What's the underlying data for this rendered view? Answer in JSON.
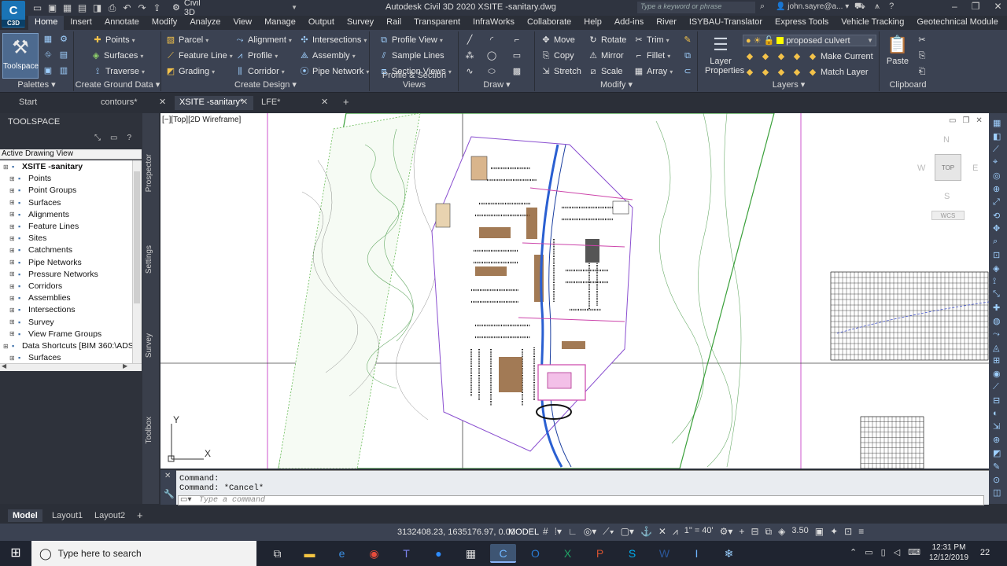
{
  "title_bar": {
    "app_logo": "C",
    "app_logo_sub": "C3D",
    "workspace": "Civil 3D",
    "window_title": "Autodesk Civil 3D 2020    XSITE -sanitary.dwg",
    "search_placeholder": "Type a keyword or phrase",
    "user": "john.sayre@a..."
  },
  "ribbon_tabs": [
    "Home",
    "Insert",
    "Annotate",
    "Modify",
    "Analyze",
    "View",
    "Manage",
    "Output",
    "Survey",
    "Rail",
    "Transparent",
    "InfraWorks",
    "Collaborate",
    "Help",
    "Add-ins",
    "River",
    "ISYBAU-Translator",
    "Express Tools",
    "Vehicle Tracking",
    "Geotechnical Module",
    "Vault"
  ],
  "active_tab": "Home",
  "ribbon": {
    "palettes": {
      "title": "Palettes",
      "toolspace": "Toolspace"
    },
    "ground": {
      "title": "Create Ground Data",
      "points": "Points",
      "surfaces": "Surfaces",
      "traverse": "Traverse"
    },
    "design": {
      "title": "Create Design",
      "parcel": "Parcel",
      "feature_line": "Feature Line",
      "grading": "Grading",
      "alignment": "Alignment",
      "profile": "Profile",
      "corridor": "Corridor",
      "intersections": "Intersections",
      "assembly": "Assembly",
      "pipe_network": "Pipe Network"
    },
    "views": {
      "title": "Profile & Section Views",
      "profile_view": "Profile View",
      "sample_lines": "Sample Lines",
      "section_views": "Section Views"
    },
    "draw": {
      "title": "Draw"
    },
    "modify": {
      "title": "Modify",
      "move": "Move",
      "copy": "Copy",
      "stretch": "Stretch",
      "rotate": "Rotate",
      "mirror": "Mirror",
      "scale": "Scale",
      "trim": "Trim",
      "fillet": "Fillet",
      "array": "Array"
    },
    "layers": {
      "title": "Layers",
      "layer_properties": "Layer Properties",
      "current_layer": "proposed culvert",
      "make_current": "Make Current",
      "match_layer": "Match Layer"
    },
    "clipboard": {
      "title": "Clipboard",
      "paste": "Paste"
    }
  },
  "doc_tabs": [
    {
      "label": "Start"
    },
    {
      "label": "contours*"
    },
    {
      "label": "XSITE -sanitary*"
    },
    {
      "label": "LFE*"
    }
  ],
  "new_tab_symbol": "+",
  "toolspace": {
    "header": "TOOLSPACE",
    "view_selector": "Active Drawing View",
    "tree": [
      {
        "label": "XSITE -sanitary",
        "level": 0,
        "bold": true
      },
      {
        "label": "Points",
        "level": 1
      },
      {
        "label": "Point Groups",
        "level": 1
      },
      {
        "label": "Surfaces",
        "level": 1
      },
      {
        "label": "Alignments",
        "level": 1
      },
      {
        "label": "Feature Lines",
        "level": 1
      },
      {
        "label": "Sites",
        "level": 1
      },
      {
        "label": "Catchments",
        "level": 1
      },
      {
        "label": "Pipe Networks",
        "level": 1
      },
      {
        "label": "Pressure Networks",
        "level": 1
      },
      {
        "label": "Corridors",
        "level": 1
      },
      {
        "label": "Assemblies",
        "level": 1
      },
      {
        "label": "Intersections",
        "level": 1
      },
      {
        "label": "Survey",
        "level": 1
      },
      {
        "label": "View Frame Groups",
        "level": 1
      },
      {
        "label": "Data Shortcuts [BIM 360:\\ADS...",
        "level": 0
      },
      {
        "label": "Surfaces",
        "level": 1
      }
    ],
    "side_tabs": [
      "Prospector",
      "Settings",
      "Survey",
      "Toolbox"
    ]
  },
  "viewport": {
    "label": "[−][Top][2D Wireframe]",
    "viewcube": {
      "n": "N",
      "s": "S",
      "e": "E",
      "w": "W",
      "top": "TOP",
      "wcs": "WCS"
    },
    "ucs_x": "X",
    "ucs_y": "Y"
  },
  "command": {
    "history": [
      "Command:",
      "Command: *Cancel*"
    ],
    "placeholder": "Type a command"
  },
  "layout_tabs": [
    "Model",
    "Layout1",
    "Layout2"
  ],
  "layout_add": "+",
  "status": {
    "coords": "3132408.23, 1635176.97, 0.00",
    "space": "MODEL",
    "scale": "1\" = 40'",
    "lineweight": "3.50"
  },
  "taskbar": {
    "search": "Type here to search",
    "time": "12:31 PM",
    "date": "12/12/2019",
    "notifications": "22"
  },
  "colors": {
    "accent": "#1a74b6",
    "ribbon": "#3b4252",
    "canvas": "#ffffff",
    "command_bg": "#e9ecf0"
  }
}
